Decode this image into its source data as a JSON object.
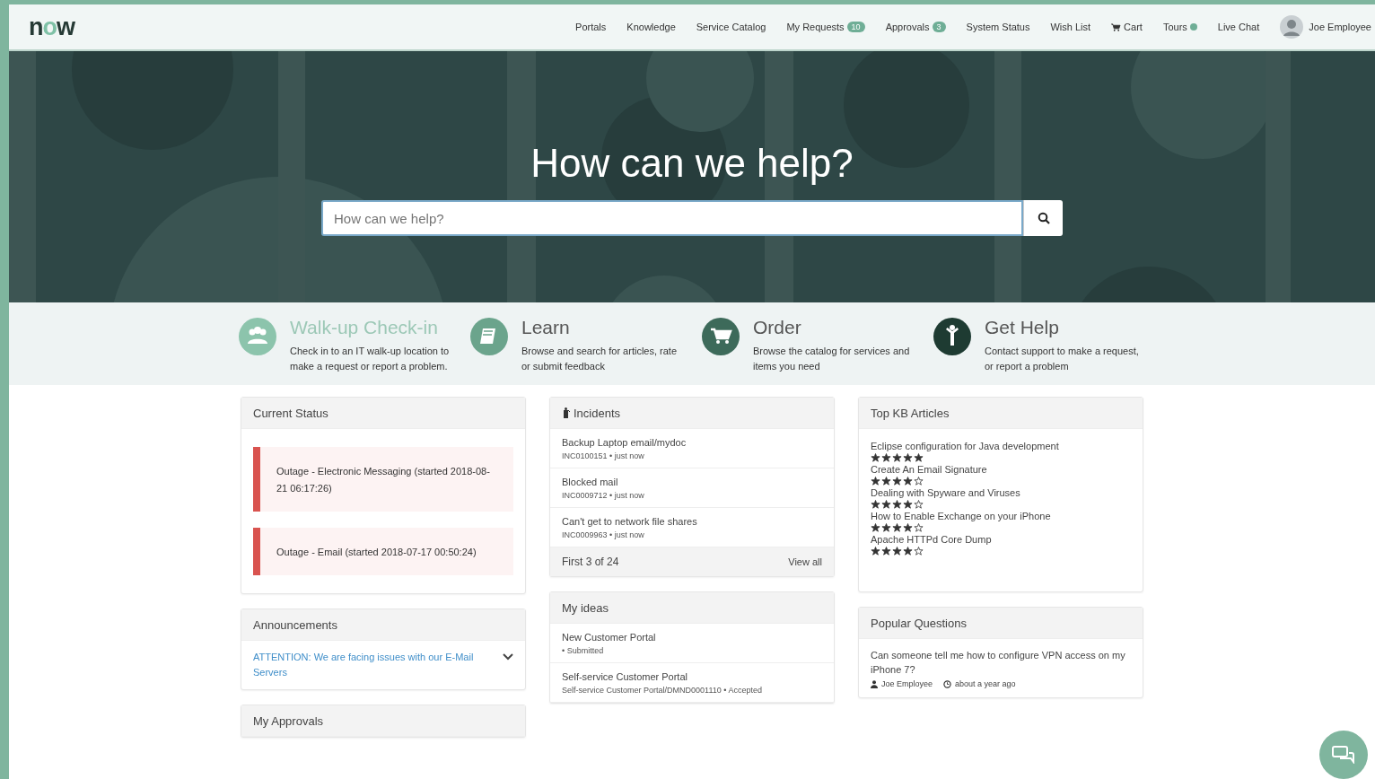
{
  "header": {
    "logo": "now",
    "nav": [
      {
        "kind": "link",
        "label": "Portals"
      },
      {
        "kind": "link",
        "label": "Knowledge"
      },
      {
        "kind": "link",
        "label": "Service Catalog"
      },
      {
        "kind": "badge",
        "label": "My Requests",
        "count": "10"
      },
      {
        "kind": "badge",
        "label": "Approvals",
        "count": "3"
      },
      {
        "kind": "link",
        "label": "System Status"
      },
      {
        "kind": "link",
        "label": "Wish List"
      },
      {
        "kind": "cart",
        "label": "Cart"
      },
      {
        "kind": "dot",
        "label": "Tours"
      },
      {
        "kind": "link",
        "label": "Live Chat"
      },
      {
        "kind": "user",
        "label": "Joe Employee"
      }
    ]
  },
  "hero": {
    "title": "How can we help?",
    "search": {
      "placeholder": "How can we help?"
    }
  },
  "features": [
    {
      "kind": "people",
      "title": "Walk-up Check-in",
      "description": "Check in to an IT walk-up location to make a request or report a problem.",
      "color": "#8cc4ac",
      "highlighted": true
    },
    {
      "kind": "book",
      "title": "Learn",
      "description": "Browse and search for articles, rate or submit feedback",
      "color": "#6ba48c",
      "highlighted": false
    },
    {
      "kind": "cart",
      "title": "Order",
      "description": "Browse the catalog for services and items you need",
      "color": "#3d6a5a",
      "highlighted": false
    },
    {
      "kind": "person",
      "title": "Get Help",
      "description": "Contact support to make a request, or report a problem",
      "color": "#1e3b32",
      "highlighted": false
    }
  ],
  "columns": [
    [
      {
        "kind": "outages",
        "title": "Current Status",
        "items": [
          "Outage - Electronic Messaging (started 2018-08-21 06:17:26)",
          "Outage - Email (started 2018-07-17 00:50:24)"
        ]
      },
      {
        "kind": "announcements",
        "title": "Announcements",
        "items": [
          {
            "text": "ATTENTION: We are facing issues with our E-Mail Servers",
            "expanded": false
          }
        ]
      },
      {
        "kind": "header",
        "title": "My Approvals"
      }
    ],
    [
      {
        "kind": "records",
        "title": "Incidents",
        "has_icon": true,
        "items": [
          {
            "title": "Backup Laptop email/mydoc",
            "meta": "INC0100151 • just now"
          },
          {
            "title": "Blocked mail",
            "meta": "INC0009712 • just now"
          },
          {
            "title": "Can't get to network file shares",
            "meta": "INC0009963 • just now"
          }
        ],
        "footer": {
          "summary": "First 3 of 24",
          "link": "View all"
        }
      },
      {
        "kind": "records",
        "title": "My ideas",
        "has_icon": false,
        "items": [
          {
            "title": "New Customer Portal",
            "meta": "• Submitted"
          },
          {
            "title": "Self-service Customer Portal",
            "meta": "Self-service Customer Portal/DMND0001110 • Accepted"
          }
        ]
      }
    ],
    [
      {
        "kind": "rated",
        "title": "Top KB Articles",
        "items": [
          {
            "title": "Eclipse configuration for Java development",
            "stars": 5
          },
          {
            "title": "Create An Email Signature",
            "stars": 4
          },
          {
            "title": "Dealing with Spyware and Viruses",
            "stars": 4
          },
          {
            "title": "How to Enable Exchange on your iPhone",
            "stars": 4
          },
          {
            "title": "Apache HTTPd Core Dump",
            "stars": 4
          }
        ]
      },
      {
        "kind": "questions",
        "title": "Popular Questions",
        "items": [
          {
            "text": "Can someone tell me how to configure VPN access on my iPhone 7?",
            "author": "Joe Employee",
            "time": "about a year ago"
          }
        ]
      }
    ]
  ]
}
